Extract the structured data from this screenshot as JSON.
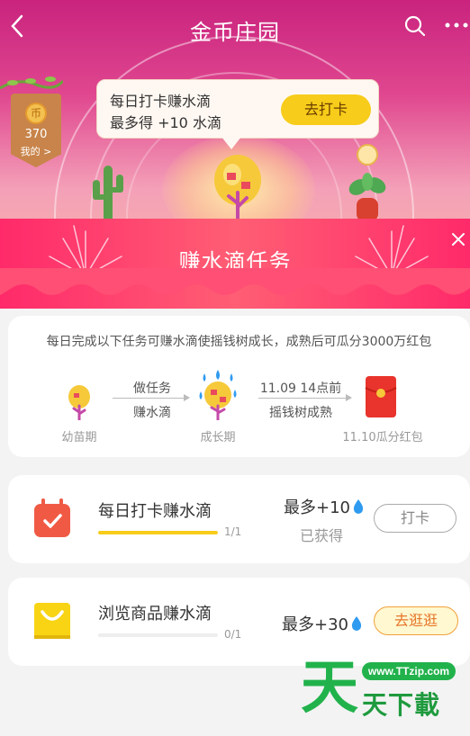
{
  "nav": {
    "back_icon": "back-arrow-icon",
    "title": "金币庄园",
    "search_icon": "search-icon",
    "more_icon": "more-icon"
  },
  "coins": {
    "icon_text": "币",
    "count": "370",
    "mine_label": "我的 >"
  },
  "bubble": {
    "line1": "每日打卡赚水滴",
    "line2": "最多得 +10 水滴",
    "button": "去打卡"
  },
  "popup": {
    "title": "赚水滴任务",
    "close_icon": "close-icon"
  },
  "info": {
    "description": "每日完成以下任务可赚水滴使摇钱树成长，成熟后可瓜分3000万红包",
    "stages": [
      {
        "label": "幼苗期",
        "icon": "seedling-tree-icon"
      },
      {
        "label": "成长期",
        "icon": "growing-tree-icon"
      },
      {
        "label": "11.10瓜分红包",
        "icon": "red-envelope-icon"
      }
    ],
    "arrows": [
      {
        "top": "做任务",
        "bottom": "赚水滴"
      },
      {
        "top": "11.09 14点前",
        "bottom": "摇钱树成熟"
      }
    ]
  },
  "tasks": [
    {
      "name": "每日打卡赚水滴",
      "progress_text": "1/1",
      "progress": 1.0,
      "reward": "最多+10",
      "status": "已获得",
      "button": "打卡",
      "icon": "calendar-check-icon"
    },
    {
      "name": "浏览商品赚水滴",
      "progress_text": "0/1",
      "progress": 0.0,
      "reward": "最多+30",
      "status": "",
      "button": "去逛逛",
      "icon": "shopping-bag-icon"
    }
  ],
  "watermark": {
    "url": "www.TTzip.com",
    "big": "天",
    "text": "天下載"
  },
  "colors": {
    "accent_pink": "#ff2a6a",
    "yellow": "#f7cc1a",
    "drop_blue": "#2f9bf0"
  }
}
